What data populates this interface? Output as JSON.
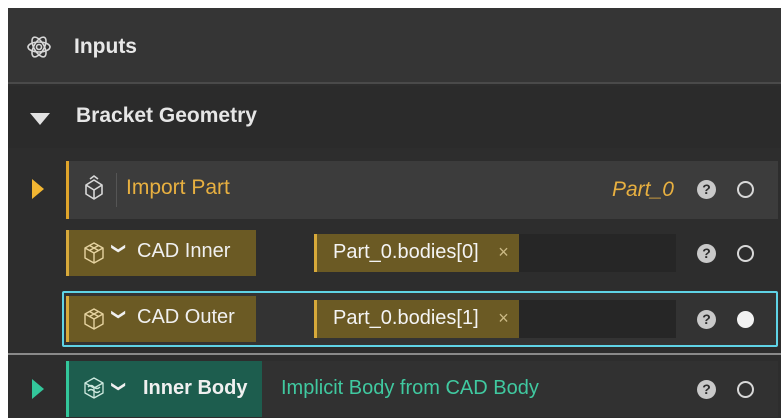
{
  "header": {
    "title": "Inputs",
    "icon": "inputs-gear-icon"
  },
  "group": {
    "title": "Bracket Geometry",
    "expanded": true
  },
  "import_part": {
    "label": "Import Part",
    "value": "Part_0",
    "help": "?",
    "icon": "import-part-icon"
  },
  "cad_inner": {
    "label": "CAD Inner",
    "chip": "Part_0.bodies[0]",
    "remove": "×",
    "help": "?",
    "status": "empty"
  },
  "cad_outer": {
    "label": "CAD Outer",
    "chip": "Part_0.bodies[1]",
    "remove": "×",
    "help": "?",
    "status": "filled"
  },
  "inner_body": {
    "label": "Inner Body",
    "description": "Implicit Body from CAD Body",
    "help": "?",
    "status": "empty"
  },
  "colors": {
    "accent_gold": "#e8b040",
    "accent_teal": "#40c9a0",
    "focus_cyan": "#5fd3e6"
  }
}
